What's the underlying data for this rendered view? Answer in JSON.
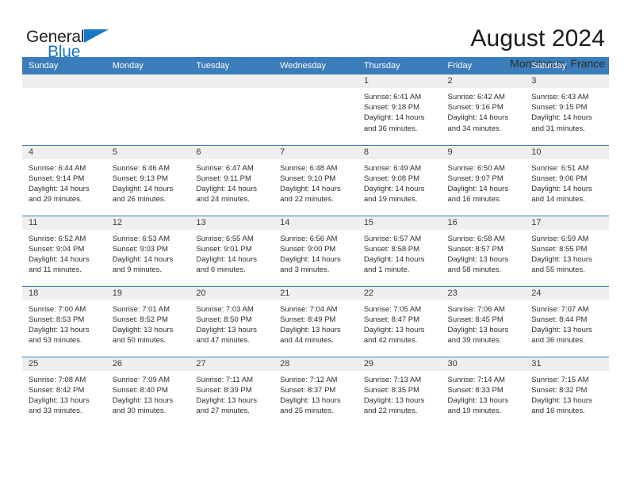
{
  "brand": {
    "name_part1": "General",
    "name_part2": "Blue",
    "color_primary": "#1877c4"
  },
  "header": {
    "title": "August 2024",
    "subtitle": "Montricoux, France"
  },
  "theme": {
    "header_blue": "#3b7cba",
    "daynum_band_gray": "#efefef",
    "text_color": "#2e2e2e"
  },
  "weekday_headers": [
    "Sunday",
    "Monday",
    "Tuesday",
    "Wednesday",
    "Thursday",
    "Friday",
    "Saturday"
  ],
  "labels": {
    "sunrise_prefix": "Sunrise:",
    "sunset_prefix": "Sunset:",
    "daylight_prefix": "Daylight:"
  },
  "weeks": [
    [
      {
        "day": "",
        "blank": true,
        "sunrise": "",
        "sunset": "",
        "daylight": ""
      },
      {
        "day": "",
        "blank": true,
        "sunrise": "",
        "sunset": "",
        "daylight": ""
      },
      {
        "day": "",
        "blank": true,
        "sunrise": "",
        "sunset": "",
        "daylight": ""
      },
      {
        "day": "",
        "blank": true,
        "sunrise": "",
        "sunset": "",
        "daylight": ""
      },
      {
        "day": "1",
        "blank": false,
        "sunrise": "Sunrise: 6:41 AM",
        "sunset": "Sunset: 9:18 PM",
        "daylight": "Daylight: 14 hours and 36 minutes."
      },
      {
        "day": "2",
        "blank": false,
        "sunrise": "Sunrise: 6:42 AM",
        "sunset": "Sunset: 9:16 PM",
        "daylight": "Daylight: 14 hours and 34 minutes."
      },
      {
        "day": "3",
        "blank": false,
        "sunrise": "Sunrise: 6:43 AM",
        "sunset": "Sunset: 9:15 PM",
        "daylight": "Daylight: 14 hours and 31 minutes."
      }
    ],
    [
      {
        "day": "4",
        "blank": false,
        "sunrise": "Sunrise: 6:44 AM",
        "sunset": "Sunset: 9:14 PM",
        "daylight": "Daylight: 14 hours and 29 minutes."
      },
      {
        "day": "5",
        "blank": false,
        "sunrise": "Sunrise: 6:46 AM",
        "sunset": "Sunset: 9:13 PM",
        "daylight": "Daylight: 14 hours and 26 minutes."
      },
      {
        "day": "6",
        "blank": false,
        "sunrise": "Sunrise: 6:47 AM",
        "sunset": "Sunset: 9:11 PM",
        "daylight": "Daylight: 14 hours and 24 minutes."
      },
      {
        "day": "7",
        "blank": false,
        "sunrise": "Sunrise: 6:48 AM",
        "sunset": "Sunset: 9:10 PM",
        "daylight": "Daylight: 14 hours and 22 minutes."
      },
      {
        "day": "8",
        "blank": false,
        "sunrise": "Sunrise: 6:49 AM",
        "sunset": "Sunset: 9:08 PM",
        "daylight": "Daylight: 14 hours and 19 minutes."
      },
      {
        "day": "9",
        "blank": false,
        "sunrise": "Sunrise: 6:50 AM",
        "sunset": "Sunset: 9:07 PM",
        "daylight": "Daylight: 14 hours and 16 minutes."
      },
      {
        "day": "10",
        "blank": false,
        "sunrise": "Sunrise: 6:51 AM",
        "sunset": "Sunset: 9:06 PM",
        "daylight": "Daylight: 14 hours and 14 minutes."
      }
    ],
    [
      {
        "day": "11",
        "blank": false,
        "sunrise": "Sunrise: 6:52 AM",
        "sunset": "Sunset: 9:04 PM",
        "daylight": "Daylight: 14 hours and 11 minutes."
      },
      {
        "day": "12",
        "blank": false,
        "sunrise": "Sunrise: 6:53 AM",
        "sunset": "Sunset: 9:03 PM",
        "daylight": "Daylight: 14 hours and 9 minutes."
      },
      {
        "day": "13",
        "blank": false,
        "sunrise": "Sunrise: 6:55 AM",
        "sunset": "Sunset: 9:01 PM",
        "daylight": "Daylight: 14 hours and 6 minutes."
      },
      {
        "day": "14",
        "blank": false,
        "sunrise": "Sunrise: 6:56 AM",
        "sunset": "Sunset: 9:00 PM",
        "daylight": "Daylight: 14 hours and 3 minutes."
      },
      {
        "day": "15",
        "blank": false,
        "sunrise": "Sunrise: 6:57 AM",
        "sunset": "Sunset: 8:58 PM",
        "daylight": "Daylight: 14 hours and 1 minute."
      },
      {
        "day": "16",
        "blank": false,
        "sunrise": "Sunrise: 6:58 AM",
        "sunset": "Sunset: 8:57 PM",
        "daylight": "Daylight: 13 hours and 58 minutes."
      },
      {
        "day": "17",
        "blank": false,
        "sunrise": "Sunrise: 6:59 AM",
        "sunset": "Sunset: 8:55 PM",
        "daylight": "Daylight: 13 hours and 55 minutes."
      }
    ],
    [
      {
        "day": "18",
        "blank": false,
        "sunrise": "Sunrise: 7:00 AM",
        "sunset": "Sunset: 8:53 PM",
        "daylight": "Daylight: 13 hours and 53 minutes."
      },
      {
        "day": "19",
        "blank": false,
        "sunrise": "Sunrise: 7:01 AM",
        "sunset": "Sunset: 8:52 PM",
        "daylight": "Daylight: 13 hours and 50 minutes."
      },
      {
        "day": "20",
        "blank": false,
        "sunrise": "Sunrise: 7:03 AM",
        "sunset": "Sunset: 8:50 PM",
        "daylight": "Daylight: 13 hours and 47 minutes."
      },
      {
        "day": "21",
        "blank": false,
        "sunrise": "Sunrise: 7:04 AM",
        "sunset": "Sunset: 8:49 PM",
        "daylight": "Daylight: 13 hours and 44 minutes."
      },
      {
        "day": "22",
        "blank": false,
        "sunrise": "Sunrise: 7:05 AM",
        "sunset": "Sunset: 8:47 PM",
        "daylight": "Daylight: 13 hours and 42 minutes."
      },
      {
        "day": "23",
        "blank": false,
        "sunrise": "Sunrise: 7:06 AM",
        "sunset": "Sunset: 8:45 PM",
        "daylight": "Daylight: 13 hours and 39 minutes."
      },
      {
        "day": "24",
        "blank": false,
        "sunrise": "Sunrise: 7:07 AM",
        "sunset": "Sunset: 8:44 PM",
        "daylight": "Daylight: 13 hours and 36 minutes."
      }
    ],
    [
      {
        "day": "25",
        "blank": false,
        "sunrise": "Sunrise: 7:08 AM",
        "sunset": "Sunset: 8:42 PM",
        "daylight": "Daylight: 13 hours and 33 minutes."
      },
      {
        "day": "26",
        "blank": false,
        "sunrise": "Sunrise: 7:09 AM",
        "sunset": "Sunset: 8:40 PM",
        "daylight": "Daylight: 13 hours and 30 minutes."
      },
      {
        "day": "27",
        "blank": false,
        "sunrise": "Sunrise: 7:11 AM",
        "sunset": "Sunset: 8:39 PM",
        "daylight": "Daylight: 13 hours and 27 minutes."
      },
      {
        "day": "28",
        "blank": false,
        "sunrise": "Sunrise: 7:12 AM",
        "sunset": "Sunset: 8:37 PM",
        "daylight": "Daylight: 13 hours and 25 minutes."
      },
      {
        "day": "29",
        "blank": false,
        "sunrise": "Sunrise: 7:13 AM",
        "sunset": "Sunset: 8:35 PM",
        "daylight": "Daylight: 13 hours and 22 minutes."
      },
      {
        "day": "30",
        "blank": false,
        "sunrise": "Sunrise: 7:14 AM",
        "sunset": "Sunset: 8:33 PM",
        "daylight": "Daylight: 13 hours and 19 minutes."
      },
      {
        "day": "31",
        "blank": false,
        "sunrise": "Sunrise: 7:15 AM",
        "sunset": "Sunset: 8:32 PM",
        "daylight": "Daylight: 13 hours and 16 minutes."
      }
    ]
  ]
}
